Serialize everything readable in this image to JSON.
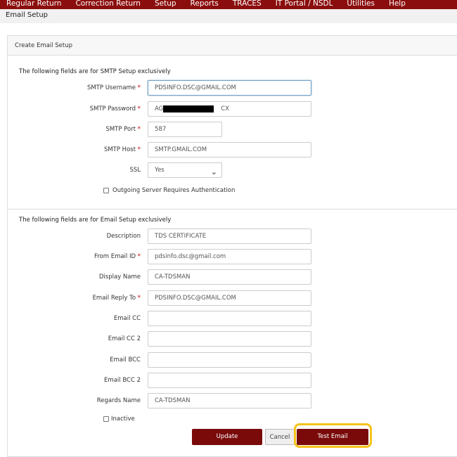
{
  "menu": [
    "Regular Return",
    "Correction Return",
    "Setup",
    "Reports",
    "TRACES",
    "IT Portal / NSDL",
    "Utilities",
    "Help"
  ],
  "breadcrumb": "Email Setup",
  "panel_title": "Create Email Setup",
  "smtp_section": {
    "heading": "The following fields are for SMTP Setup exclusively",
    "username_label": "SMTP Username",
    "username": "PDSINFO.DSC@GMAIL.COM",
    "password_label": "SMTP Password",
    "password_start": "AG",
    "password_end": "CX",
    "port_label": "SMTP Port",
    "port": "587",
    "host_label": "SMTP Host",
    "host": "SMTP.GMAIL.COM",
    "ssl_label": "SSL",
    "ssl": "Yes",
    "auth_label": "Outgoing Server Requires Authentication"
  },
  "email_section": {
    "heading": "The following fields are for Email Setup exclusively",
    "description_label": "Description",
    "description": "TDS CERTIFICATE",
    "from_label": "From Email ID",
    "from": "pdsinfo.dsc@gmail.com",
    "display_label": "Display Name",
    "display": "CA-TDSMAN",
    "reply_label": "Email Reply To",
    "reply": "PDSINFO.DSC@GMAIL.COM",
    "cc_label": "Email CC",
    "cc": "",
    "cc2_label": "Email CC 2",
    "cc2": "",
    "bcc_label": "Email BCC",
    "bcc": "",
    "bcc2_label": "Email BCC 2",
    "bcc2": "",
    "regards_label": "Regards Name",
    "regards": "CA-TDSMAN",
    "inactive_label": "Inactive"
  },
  "required_mark": "*",
  "buttons": {
    "update": "Update",
    "cancel": "Cancel",
    "test": "Test Email"
  }
}
